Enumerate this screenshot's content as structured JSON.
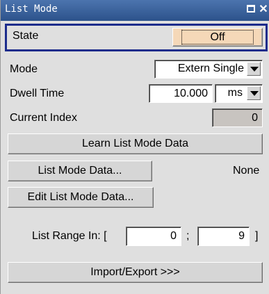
{
  "window": {
    "title": "List Mode"
  },
  "state": {
    "label": "State",
    "value": "Off"
  },
  "mode": {
    "label": "Mode",
    "value": "Extern Single"
  },
  "dwell": {
    "label": "Dwell Time",
    "value": "10.000",
    "unit": "ms"
  },
  "current_index": {
    "label": "Current Index",
    "value": "0"
  },
  "learn_button": "Learn List Mode Data",
  "list_mode_data": {
    "button": "List Mode Data...",
    "value": "None"
  },
  "edit_button": "Edit List Mode Data...",
  "range": {
    "label": "List Range In: [",
    "start": "0",
    "sep": ";",
    "stop": "9",
    "end": "]"
  },
  "import_export_button": "Import/Export >>>"
}
